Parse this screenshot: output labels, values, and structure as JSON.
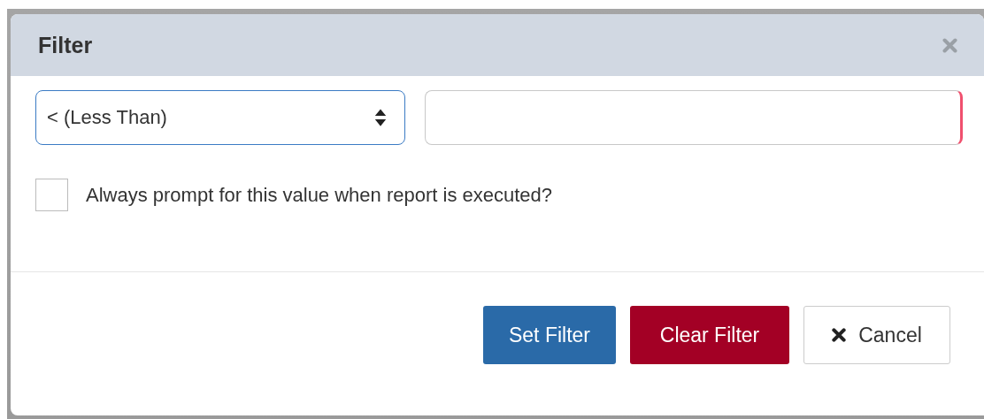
{
  "dialog": {
    "title": "Filter"
  },
  "operator_select": {
    "value": "< (Less Than)",
    "focused": true
  },
  "value_field": {
    "invalid": true
  },
  "prompt_checkbox": {
    "label": "Always prompt for this value when report is executed?",
    "checked": false
  },
  "buttons": [
    {
      "label": "Set Filter",
      "kind": "primary"
    },
    {
      "label": "Clear Filter",
      "kind": "danger"
    },
    {
      "label": "Cancel",
      "kind": "cancel"
    }
  ]
}
